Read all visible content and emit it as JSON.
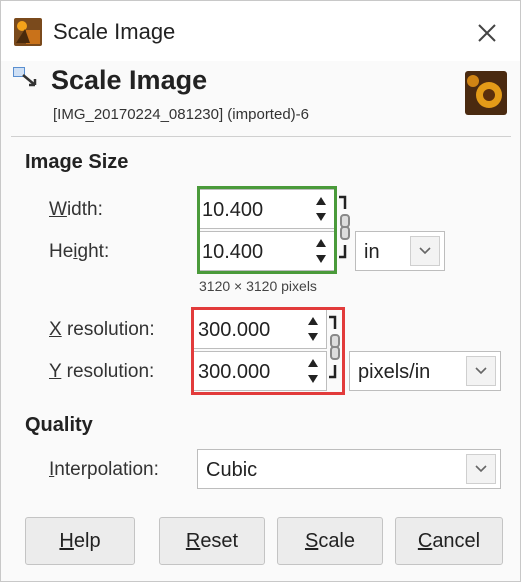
{
  "window": {
    "title": "Scale Image",
    "close_glyph": "✕"
  },
  "header": {
    "heading": "Scale Image",
    "subtitle": "[IMG_20170224_081230] (imported)-6"
  },
  "image_size": {
    "section_title": "Image Size",
    "width_label_u": "W",
    "width_label_rest": "idth:",
    "width_value": "10.400",
    "height_label_pre": "He",
    "height_label_u": "i",
    "height_label_rest": "ght:",
    "height_value": "10.400",
    "unit": "in",
    "pixels_note": "3120 × 3120 pixels",
    "x_res_label_u": "X",
    "x_res_label_rest": " resolution:",
    "x_res_value": "300.000",
    "y_res_label_u": "Y",
    "y_res_label_rest": " resolution:",
    "y_res_value": "300.000",
    "res_unit": "pixels/in"
  },
  "quality": {
    "section_title": "Quality",
    "interp_label_u": "I",
    "interp_label_rest": "nterpolation:",
    "interpolation": "Cubic"
  },
  "buttons": {
    "help_u": "H",
    "help_rest": "elp",
    "reset_u": "R",
    "reset_rest": "eset",
    "scale_u": "S",
    "scale_rest": "cale",
    "cancel_u": "C",
    "cancel_rest": "ancel"
  },
  "colors": {
    "highlight_size": "#4a9a3a",
    "highlight_resolution": "#e23b3b"
  },
  "icons": [
    "gimp-app-icon",
    "close-icon",
    "scale-tool-icon",
    "image-thumbnail",
    "spin-arrows-icon",
    "chain-link-icon",
    "chevron-down-icon"
  ]
}
